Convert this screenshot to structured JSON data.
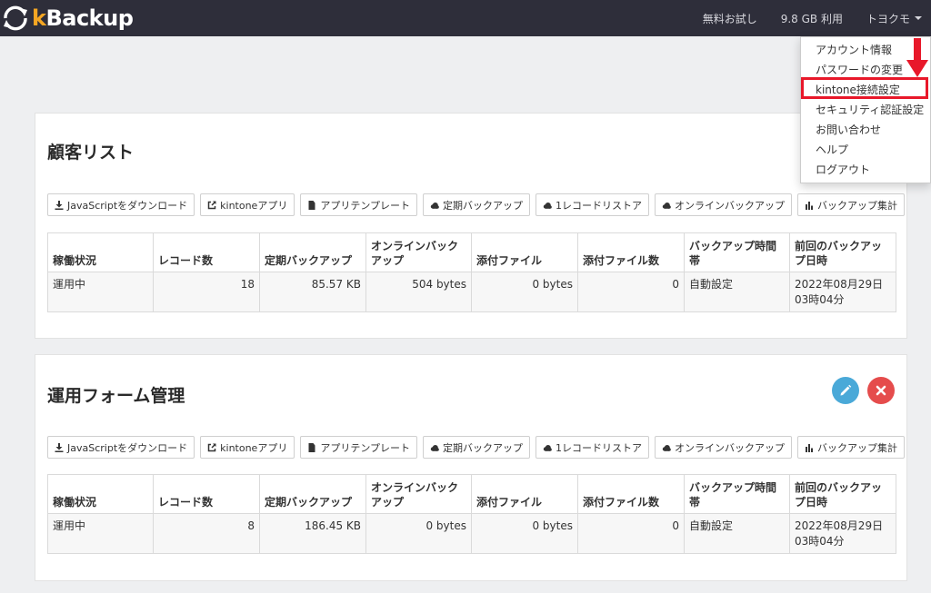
{
  "brand": {
    "logo_prefix": "k",
    "logo_suffix": "Backup"
  },
  "nav": {
    "free_trial": "無料お試し",
    "usage": "9.8 GB 利用",
    "user": "トヨクモ"
  },
  "user_menu": {
    "items": [
      "アカウント情報",
      "パスワードの変更",
      "kintone接続設定",
      "セキュリティ認証設定",
      "お問い合わせ",
      "ヘルプ",
      "ログアウト"
    ],
    "highlighted_index": 2,
    "annotation_color": "#e8182a"
  },
  "toolbar_labels": {
    "download_js": "JavaScriptをダウンロード",
    "kintone_app": "kintoneアプリ",
    "app_template": "アプリテンプレート",
    "scheduled_backup": "定期バックアップ",
    "one_record_restore": "1レコードリストア",
    "online_backup": "オンラインバックアップ",
    "backup_summary": "バックアップ集計"
  },
  "table_headers": {
    "status": "稼働状況",
    "record_count": "レコード数",
    "scheduled_backup": "定期バックアップ",
    "online_backup": "オンラインバックアップ",
    "attachments": "添付ファイル",
    "attachment_count": "添付ファイル数",
    "backup_time": "バックアップ時間帯",
    "last_backup": "前回のバックアップ日時"
  },
  "apps": [
    {
      "title": "顧客リスト",
      "row": {
        "status": "運用中",
        "record_count": "18",
        "scheduled_backup": "85.57 KB",
        "online_backup": "504 bytes",
        "attachments": "0 bytes",
        "attachment_count": "0",
        "backup_time": "自動設定",
        "last_backup": "2022年08月29日 03時04分"
      }
    },
    {
      "title": "運用フォーム管理",
      "row": {
        "status": "運用中",
        "record_count": "8",
        "scheduled_backup": "186.45 KB",
        "online_backup": "0 bytes",
        "attachments": "0 bytes",
        "attachment_count": "0",
        "backup_time": "自動設定",
        "last_backup": "2022年08月29日 03時04分"
      }
    }
  ],
  "colors": {
    "navbar": "#2e2e3a",
    "accent": "#f5a623",
    "edit": "#4aa9d8",
    "delete": "#e54c4c"
  },
  "icons": [
    "sync-logo-icon",
    "download-icon",
    "external-link-icon",
    "file-icon",
    "cloud-icon",
    "bar-chart-icon",
    "pencil-icon",
    "close-icon",
    "caret-down-icon"
  ]
}
